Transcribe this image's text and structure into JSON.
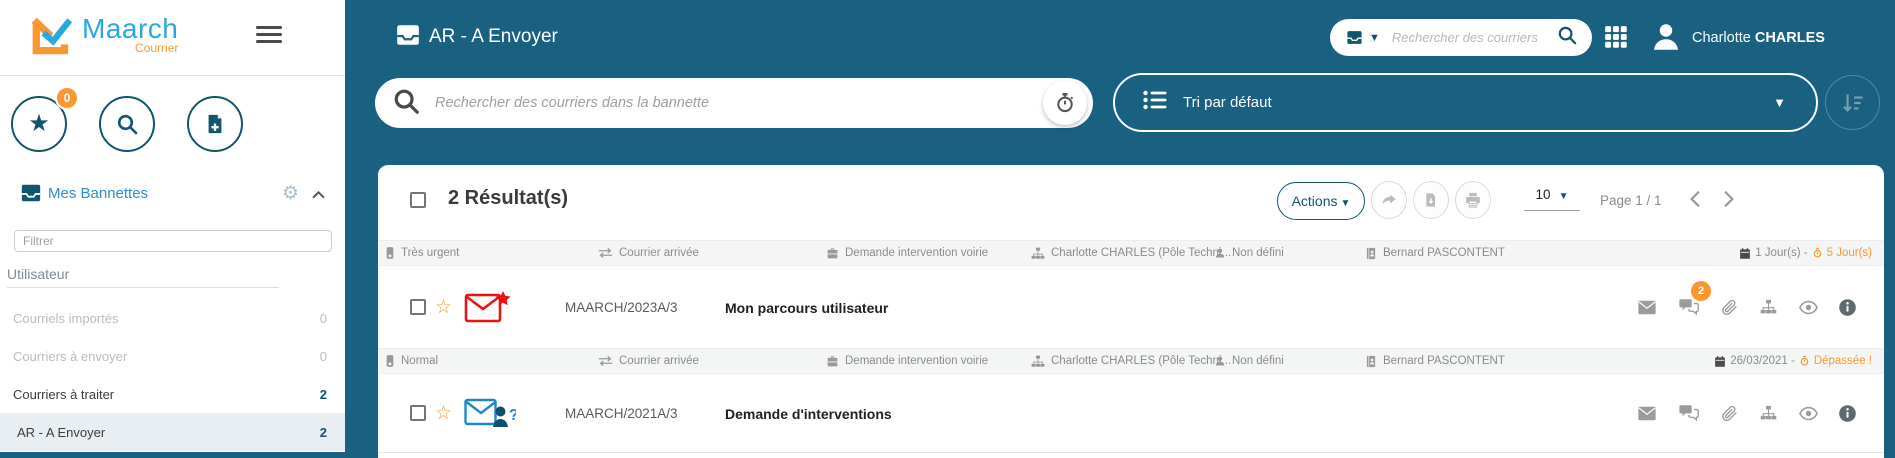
{
  "sidebar": {
    "logo": {
      "name": "Maarch",
      "sub": "Courrier"
    },
    "fav_badge": "0",
    "panel_title": "Mes Bannettes",
    "filter_placeholder": "Filtrer",
    "group_label": "Utilisateur",
    "items": [
      {
        "label": "Courriels importés",
        "count": "0",
        "state": "disabled"
      },
      {
        "label": "Courriers à envoyer",
        "count": "0",
        "state": "disabled"
      },
      {
        "label": "Courriers à traiter",
        "count": "2",
        "state": "normal"
      },
      {
        "label": "AR - A Envoyer",
        "count": "2",
        "state": "selected"
      }
    ]
  },
  "header": {
    "title": "AR - A Envoyer",
    "quick_search_placeholder": "Rechercher des courriers",
    "user_first": "Charlotte",
    "user_last": "CHARLES"
  },
  "filterbar": {
    "search_placeholder": "Rechercher des courriers dans la bannette",
    "sort_label": "Tri par défaut"
  },
  "toolbar": {
    "results": "2 Résultat(s)",
    "actions_label": "Actions",
    "page_size": "10",
    "page_label": "Page 1 / 1"
  },
  "rows": [
    {
      "meta": {
        "priority": "Très urgent",
        "nature": "Courrier arrivée",
        "doctype": "Demande intervention voirie",
        "entity": "Charlotte CHARLES (Pôle Techni...",
        "sender": "Non défini",
        "recipient": "Bernard PASCONTENT",
        "date_normal": "1 Jour(s) - ",
        "date_alert": "5 Jour(s)"
      },
      "ref": "MAARCH/2023A/3",
      "subject": "Mon parcours utilisateur",
      "chat_badge": "2"
    },
    {
      "meta": {
        "priority": "Normal",
        "nature": "Courrier arrivée",
        "doctype": "Demande intervention voirie",
        "entity": "Charlotte CHARLES (Pôle Techni...",
        "sender": "Non défini",
        "recipient": "Bernard PASCONTENT",
        "date_normal": "26/03/2021 - ",
        "date_alert": "Dépassée !"
      },
      "ref": "MAARCH/2021A/3",
      "subject": "Demande d'interventions"
    }
  ],
  "colors": {
    "teal_header": "#1A6080",
    "dark_teal": "#11556E",
    "accent_orange": "#F99830",
    "link_blue": "#2B8FC6",
    "urgent_red": "#EA1313",
    "info_blue": "#1E88C7"
  }
}
